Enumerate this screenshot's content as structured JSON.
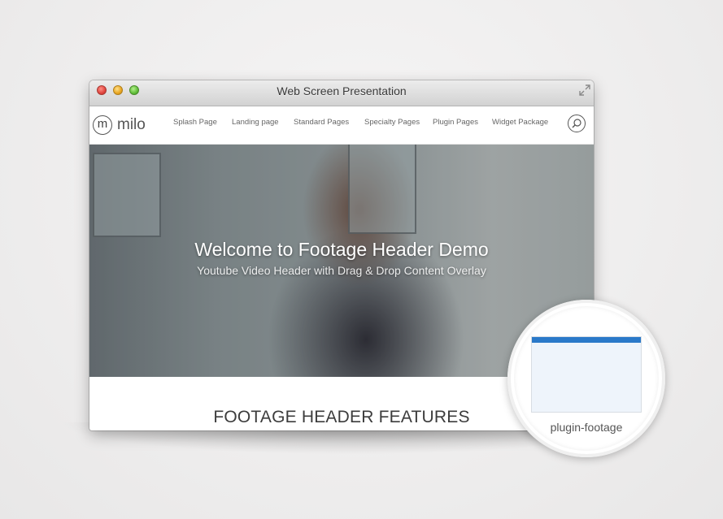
{
  "window": {
    "title": "Web Screen Presentation"
  },
  "site": {
    "logo_mark": "m",
    "logo_text": "milo",
    "nav": [
      {
        "label": "Splash Page"
      },
      {
        "label": "Landing page"
      },
      {
        "label": "Standard Pages"
      },
      {
        "label": "Specialty Pages"
      },
      {
        "label": "Plugin Pages"
      },
      {
        "label": "Widget Package"
      }
    ]
  },
  "hero": {
    "title": "Welcome to Footage Header Demo",
    "subtitle": "Youtube Video Header with Drag & Drop Content Overlay"
  },
  "section": {
    "title": "FOOTAGE HEADER FEATURES"
  },
  "badge": {
    "label": "plugin-footage",
    "accent_color": "#2a79c9"
  },
  "icons": {
    "expand": "expand-icon",
    "search": "search-icon"
  }
}
